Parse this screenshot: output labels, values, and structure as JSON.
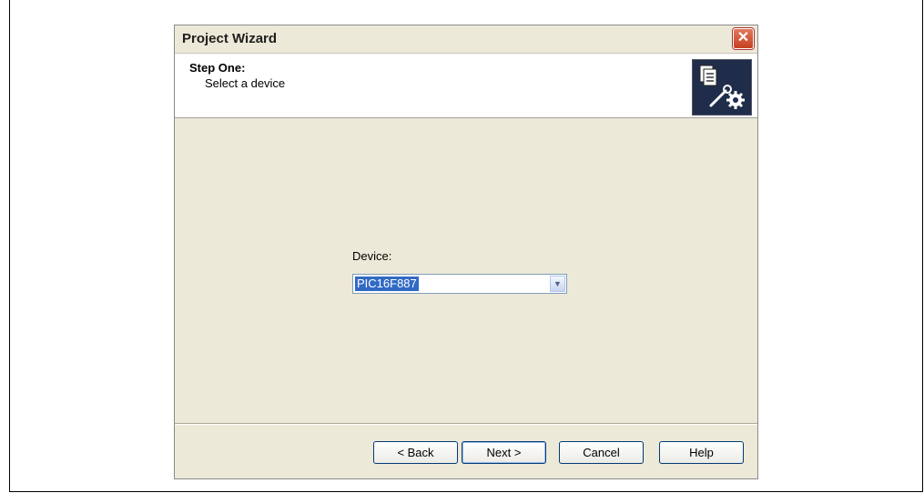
{
  "window": {
    "title": "Project Wizard"
  },
  "header": {
    "step_title": "Step One:",
    "step_subtitle": "Select a device"
  },
  "device": {
    "label": "Device:",
    "value": "PIC16F887"
  },
  "buttons": {
    "back": "< Back",
    "next": "Next >",
    "cancel": "Cancel",
    "help": "Help"
  },
  "icons": {
    "close": "close-icon",
    "wizard": "wizard-icon",
    "dropdown": "chevron-down-icon"
  }
}
